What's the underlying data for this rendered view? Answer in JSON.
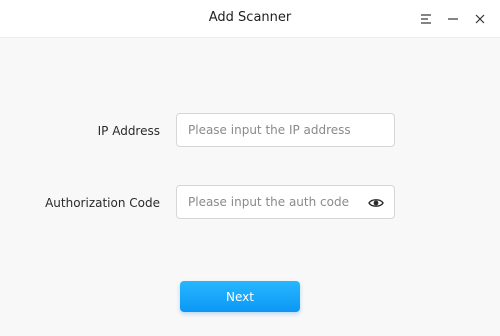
{
  "window": {
    "title": "Add Scanner",
    "controls": [
      "menu-icon",
      "minimize-icon",
      "close-icon"
    ]
  },
  "form": {
    "ip_label": "IP Address",
    "ip_value": "",
    "ip_placeholder": "Please input the IP address",
    "auth_label": "Authorization Code",
    "auth_value": "",
    "auth_placeholder": "Please input the auth code",
    "auth_toggle_icon": "eye-icon"
  },
  "actions": {
    "next_label": "Next"
  },
  "colors": {
    "accent": "#0c97f5",
    "accent_light": "#27b7ff"
  }
}
